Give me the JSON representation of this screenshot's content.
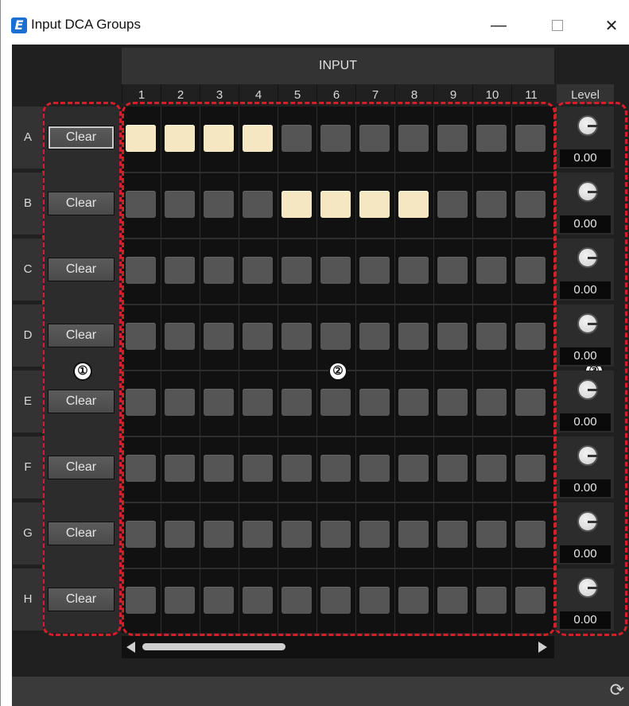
{
  "window": {
    "title": "Input DCA Groups",
    "minimize_icon": "minimize-icon",
    "maximize_icon": "maximize-icon",
    "close_icon": "close-icon"
  },
  "header": {
    "input_label": "INPUT",
    "level_label": "Level",
    "columns": [
      "1",
      "2",
      "3",
      "4",
      "5",
      "6",
      "7",
      "8",
      "9",
      "10",
      "11"
    ]
  },
  "rows": [
    {
      "label": "A",
      "clear": "Clear",
      "assigned": [
        1,
        2,
        3,
        4
      ],
      "level": "0.00"
    },
    {
      "label": "B",
      "clear": "Clear",
      "assigned": [
        5,
        6,
        7,
        8
      ],
      "level": "0.00"
    },
    {
      "label": "C",
      "clear": "Clear",
      "assigned": [],
      "level": "0.00"
    },
    {
      "label": "D",
      "clear": "Clear",
      "assigned": [],
      "level": "0.00"
    },
    {
      "label": "E",
      "clear": "Clear",
      "assigned": [],
      "level": "0.00"
    },
    {
      "label": "F",
      "clear": "Clear",
      "assigned": [],
      "level": "0.00"
    },
    {
      "label": "G",
      "clear": "Clear",
      "assigned": [],
      "level": "0.00"
    },
    {
      "label": "H",
      "clear": "Clear",
      "assigned": [],
      "level": "0.00"
    }
  ],
  "callouts": [
    "①",
    "②",
    "③"
  ],
  "colors": {
    "assigned": "#f4e7c2",
    "unassigned": "#555555",
    "highlight": "#d31f2a",
    "background": "#202020"
  },
  "icons": {
    "app": "app-logo-icon",
    "refresh": "refresh-icon",
    "scroll_left": "arrow-left-icon",
    "scroll_right": "arrow-right-icon"
  }
}
